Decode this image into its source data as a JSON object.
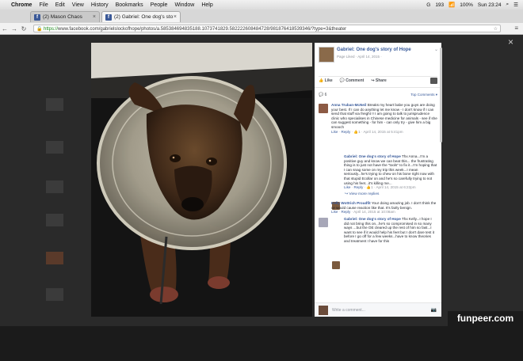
{
  "menubar": {
    "app": "Chrome",
    "items": [
      "File",
      "Edit",
      "View",
      "History",
      "Bookmarks",
      "People",
      "Window",
      "Help"
    ],
    "status_right": [
      "193",
      "100%",
      "Sun 23:24"
    ]
  },
  "tabs": [
    {
      "label": "(2) Mason Chaos",
      "active": false
    },
    {
      "label": "(2) Gabriel: One dog's sto",
      "active": true
    }
  ],
  "address": {
    "scheme": "https://",
    "rest": "www.facebook.com/gabrielslockofhope/photos/a.585384694835188.1073741829.582222608484728/981876418539346/?type=3&theater"
  },
  "post": {
    "page_name": "Gabriel: One dog's story of Hope",
    "meta": "Page Liked · April 14, 2015 ·",
    "actions": [
      "Like",
      "Comment",
      "Share"
    ],
    "comments_label": "6",
    "top_comments": "Top Comments ▾"
  },
  "comments": [
    {
      "name": "Anna Truban-McNeil",
      "text": "Breaks my heart babe you guys are doing your best. If I can do anything let me know - I don't know if I can send that stuff via freight !! I am going to talk to jurisprudence clinic who specialises in Chinese medicine for animals - see if she can suggest something - for him - can only try - give him a big smooch",
      "meta_like": "Like",
      "meta_reply": "Reply",
      "meta_rest": "· 👍1 · April 14, 2015 at 5:41pm"
    },
    {
      "name": "Gabriel: One dog's story of Hope",
      "text": "Thx Anna...I'm a positive guy and know we can beat this... the frustrating thing is to just not have the \"tools\" to fix it...I'm hoping that I can snag some on my trip this week...I mean seriously...he's trying to chew on his bone right now with that stupid Ecollar on and he's so carefully trying to not using his feet...it's killing me...",
      "meta_like": "Like",
      "meta_reply": "Reply",
      "meta_rest": "· 👍1 · April 14, 2015 at 6:22pm"
    },
    {
      "name": "Kelly Wottrich Proudfit",
      "text": "Your doing amazing job. I don't think the ce would cause reaction like that. It's fairly benign.",
      "meta_like": "Like",
      "meta_reply": "Reply",
      "meta_rest": "· April 14, 2015 at 10:08am"
    },
    {
      "name": "Gabriel: One dog's story of Hope",
      "text": "Thx Kelly...I hope I did not bring this on...he's so compromised in so many ways ...but the OE cleared up the rest of him so fast...I want to see if it would help his feet but I don't dare test it before I go off for a few weeks...have to know theories and treatment I have for this",
      "meta_like": "",
      "meta_reply": "",
      "meta_rest": ""
    }
  ],
  "view_more": "View more replies",
  "write_placeholder": "Write a comment...",
  "watermark": "funpeer.com"
}
